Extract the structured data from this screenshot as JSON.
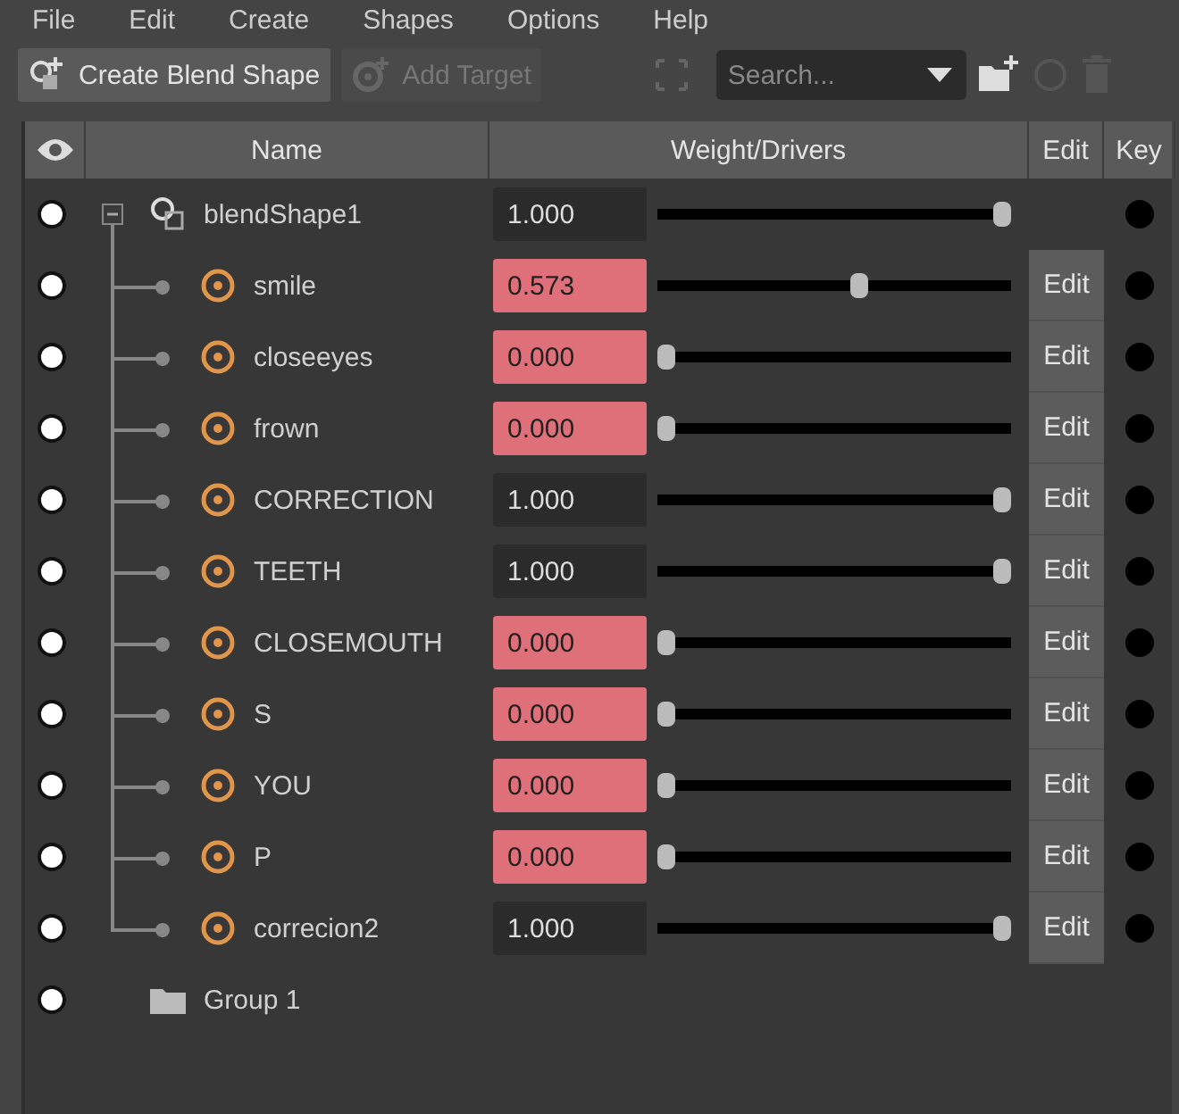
{
  "menu": [
    "File",
    "Edit",
    "Create",
    "Shapes",
    "Options",
    "Help"
  ],
  "toolbar": {
    "create_button": "Create Blend Shape",
    "add_target_button": {
      "label": "Add Target",
      "disabled": true
    },
    "search": {
      "placeholder": "Search..."
    }
  },
  "columns": [
    "Name",
    "Weight/Drivers",
    "Edit",
    "Key"
  ],
  "tree": [
    {
      "kind": "blendshape",
      "name": "blendShape1",
      "expanded": true,
      "weight": "1.000",
      "level": 1,
      "keyed": false,
      "children": [
        {
          "kind": "target",
          "name": "smile",
          "weight": "0.573",
          "level": 0.573,
          "keyed": true,
          "edit": "Edit"
        },
        {
          "kind": "target",
          "name": "closeeyes",
          "weight": "0.000",
          "level": 0,
          "keyed": true,
          "edit": "Edit"
        },
        {
          "kind": "target",
          "name": "frown",
          "weight": "0.000",
          "level": 0,
          "keyed": true,
          "edit": "Edit"
        },
        {
          "kind": "target",
          "name": "CORRECTION",
          "weight": "1.000",
          "level": 1,
          "keyed": false,
          "edit": "Edit"
        },
        {
          "kind": "target",
          "name": "TEETH",
          "weight": "1.000",
          "level": 1,
          "keyed": false,
          "edit": "Edit"
        },
        {
          "kind": "target",
          "name": "CLOSEMOUTH",
          "weight": "0.000",
          "level": 0,
          "keyed": true,
          "edit": "Edit"
        },
        {
          "kind": "target",
          "name": "S",
          "weight": "0.000",
          "level": 0,
          "keyed": true,
          "edit": "Edit"
        },
        {
          "kind": "target",
          "name": "YOU",
          "weight": "0.000",
          "level": 0,
          "keyed": true,
          "edit": "Edit"
        },
        {
          "kind": "target",
          "name": "P",
          "weight": "0.000",
          "level": 0,
          "keyed": true,
          "edit": "Edit"
        },
        {
          "kind": "target",
          "name": "correcion2",
          "weight": "1.000",
          "level": 1,
          "keyed": false,
          "edit": "Edit"
        }
      ]
    },
    {
      "kind": "group",
      "name": "Group 1"
    }
  ]
}
